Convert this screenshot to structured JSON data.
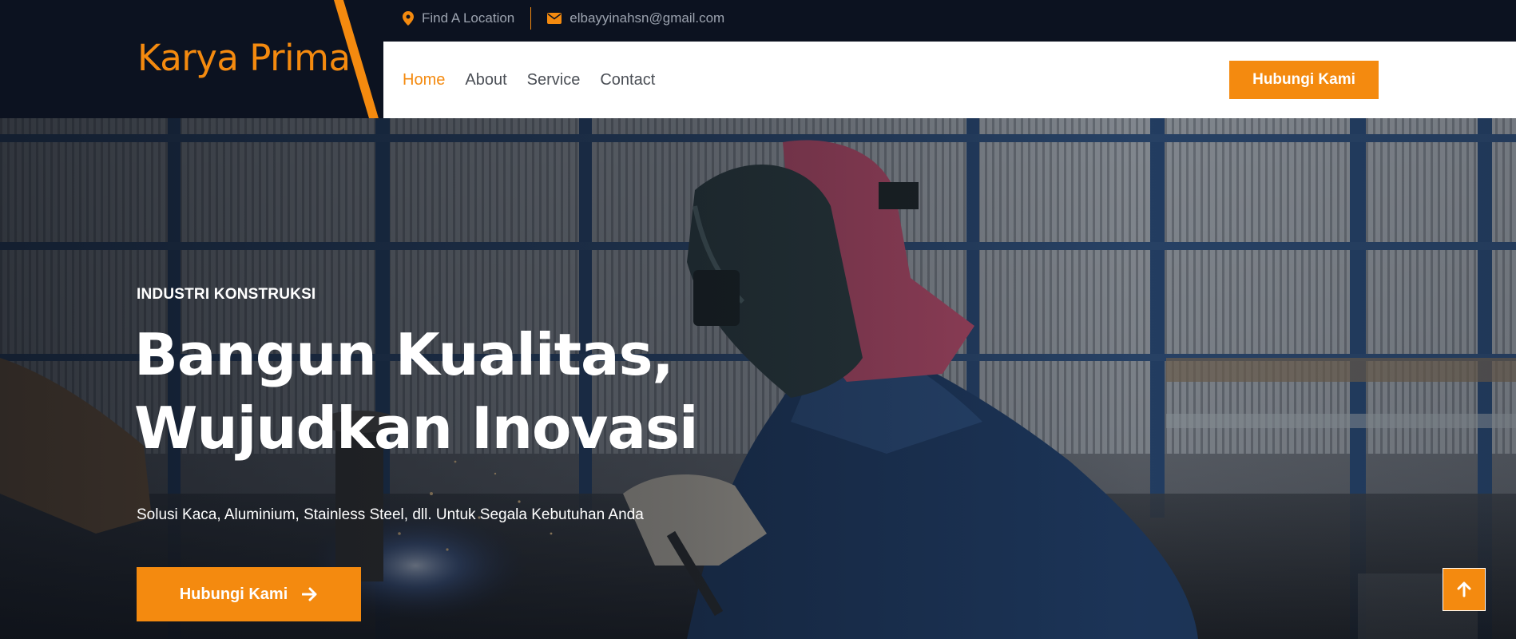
{
  "brand": {
    "name": "Karya Prima"
  },
  "contact": {
    "location_label": "Find A Location",
    "email": "elbayyinahsn@gmail.com"
  },
  "nav": {
    "items": [
      {
        "label": "Home",
        "active": true
      },
      {
        "label": "About",
        "active": false
      },
      {
        "label": "Service",
        "active": false
      },
      {
        "label": "Contact",
        "active": false
      }
    ],
    "cta_label": "Hubungi Kami"
  },
  "hero": {
    "eyebrow": "INDUSTRI KONSTRUKSI",
    "headline_line1": "Bangun Kualitas,",
    "headline_line2": "Wujudkan Inovasi",
    "subtitle": "Solusi Kaca, Aluminium, Stainless Steel, dll. Untuk Segala Kebutuhan Anda",
    "cta_label": "Hubungi Kami"
  },
  "icons": {
    "location": "map-pin-icon",
    "email": "envelope-icon",
    "cta_arrow": "arrow-right-icon",
    "scroll_top": "arrow-up-icon"
  },
  "colors": {
    "accent": "#f48a0f",
    "dark": "#0c1220",
    "nav_bg": "#ffffff",
    "nav_text": "#4b4f56"
  }
}
